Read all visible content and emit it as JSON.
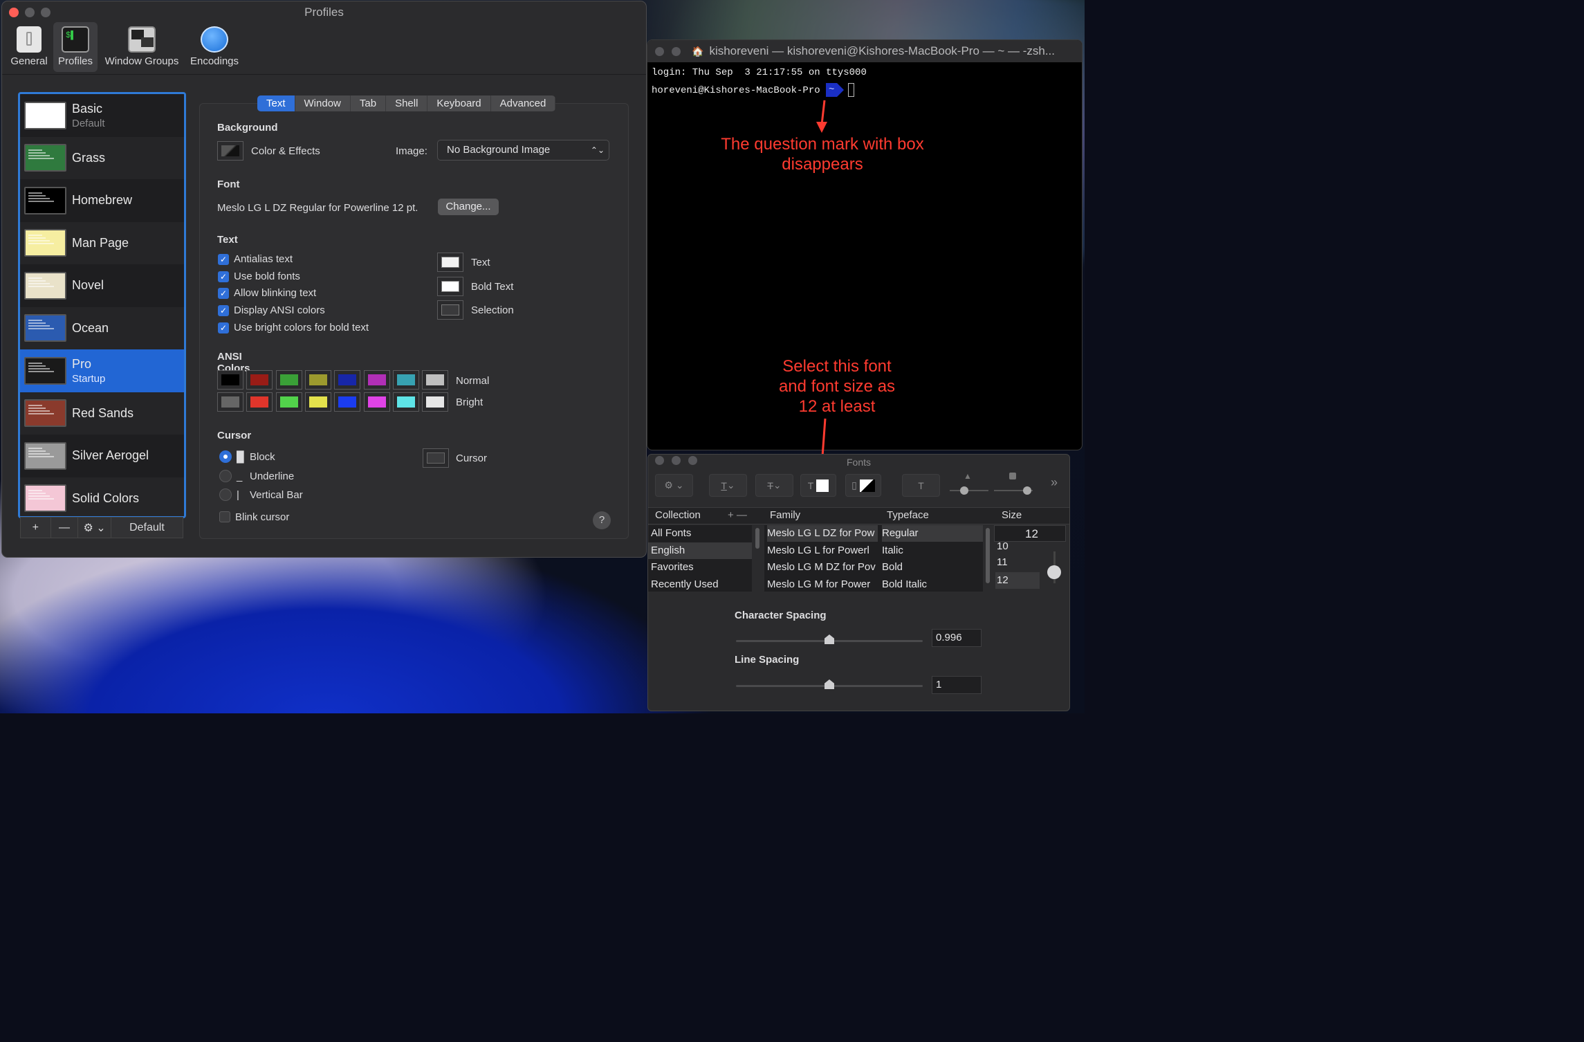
{
  "profiles_window": {
    "title": "Profiles",
    "toolbar": [
      {
        "label": "General",
        "icon": "switch-icon"
      },
      {
        "label": "Profiles",
        "icon": "terminal-icon",
        "selected": true
      },
      {
        "label": "Window Groups",
        "icon": "window-groups-icon"
      },
      {
        "label": "Encodings",
        "icon": "globe-icon"
      }
    ],
    "profiles": [
      {
        "name": "Basic",
        "sub": "Default",
        "thumb": "#ffffff"
      },
      {
        "name": "Grass",
        "sub": "",
        "thumb": "#2f7a3e"
      },
      {
        "name": "Homebrew",
        "sub": "",
        "thumb": "#000000"
      },
      {
        "name": "Man Page",
        "sub": "",
        "thumb": "#f6eea1"
      },
      {
        "name": "Novel",
        "sub": "",
        "thumb": "#e9e2c9"
      },
      {
        "name": "Ocean",
        "sub": "",
        "thumb": "#2b5bb0"
      },
      {
        "name": "Pro",
        "sub": "Startup",
        "thumb": "#1a1a1a",
        "selected": true
      },
      {
        "name": "Red Sands",
        "sub": "",
        "thumb": "#8a3a2c"
      },
      {
        "name": "Silver Aerogel",
        "sub": "",
        "thumb": "#9a9a9a"
      },
      {
        "name": "Solid Colors",
        "sub": "",
        "thumb": "#f4c7d6"
      }
    ],
    "sidebar_buttons": {
      "add": "+",
      "remove": "—",
      "gear": "⚙ ⌄",
      "default": "Default"
    },
    "tabs": [
      "Text",
      "Window",
      "Tab",
      "Shell",
      "Keyboard",
      "Advanced"
    ],
    "active_tab": "Text",
    "background": {
      "heading": "Background",
      "color_effects": "Color & Effects",
      "image_label": "Image:",
      "image_value": "No Background Image"
    },
    "font": {
      "heading": "Font",
      "value": "Meslo LG L DZ Regular for Powerline 12 pt.",
      "change_button": "Change..."
    },
    "text": {
      "heading": "Text",
      "options": [
        {
          "label": "Antialias text",
          "checked": true
        },
        {
          "label": "Use bold fonts",
          "checked": true
        },
        {
          "label": "Allow blinking text",
          "checked": true
        },
        {
          "label": "Display ANSI colors",
          "checked": true
        },
        {
          "label": "Use bright colors for bold text",
          "checked": true
        }
      ],
      "color_wells": [
        {
          "label": "Text",
          "color": "#f2f2f2"
        },
        {
          "label": "Bold Text",
          "color": "#ffffff"
        },
        {
          "label": "Selection",
          "color": "#3a3a3c"
        }
      ]
    },
    "ansi": {
      "heading": "ANSI Colors",
      "normal_label": "Normal",
      "bright_label": "Bright",
      "normal": [
        "#000000",
        "#991c16",
        "#3aa037",
        "#9c9a2e",
        "#1726a8",
        "#b12fb6",
        "#37a2b2",
        "#bfbfbf"
      ],
      "bright": [
        "#666666",
        "#e0352b",
        "#52d34b",
        "#e4e24c",
        "#1b3cf0",
        "#e043e6",
        "#5ee4e7",
        "#e6e6e6"
      ]
    },
    "cursor": {
      "heading": "Cursor",
      "options": [
        {
          "label": "Block",
          "glyph": "█",
          "selected": true
        },
        {
          "label": "Underline",
          "glyph": "_",
          "selected": false
        },
        {
          "label": "Vertical Bar",
          "glyph": "|",
          "selected": false
        }
      ],
      "blink_label": "Blink cursor",
      "cursor_well_label": "Cursor",
      "cursor_color": "#3a3a3c"
    },
    "help": "?"
  },
  "terminal": {
    "title": "kishoreveni — kishoreveni@Kishores-MacBook-Pro — ~ — -zsh...",
    "line1": "login: Thu Sep  3 21:17:55 on ttys000",
    "prompt": "horeveni@Kishores-MacBook-Pro",
    "dir": "~"
  },
  "annotations": {
    "top": [
      "The question mark with box",
      "disappears"
    ],
    "bottom": [
      "Select this font",
      "and font size as",
      "12 at least"
    ]
  },
  "fonts_panel": {
    "title": "Fonts",
    "headers": {
      "collection": "Collection",
      "family": "Family",
      "typeface": "Typeface",
      "size": "Size"
    },
    "collections": [
      "All Fonts",
      "English",
      "Favorites",
      "Recently Used"
    ],
    "selected_collection": "English",
    "families": [
      "Meslo LG L DZ for Pow",
      "Meslo LG L for Powerl",
      "Meslo LG M DZ for Pov",
      "Meslo LG M for Power"
    ],
    "typefaces": [
      "Regular",
      "Italic",
      "Bold",
      "Bold Italic"
    ],
    "size_value": "12",
    "sizes": [
      "10",
      "11",
      "12"
    ],
    "char_spacing_label": "Character Spacing",
    "char_spacing_value": "0.996",
    "line_spacing_label": "Line Spacing",
    "line_spacing_value": "1"
  }
}
